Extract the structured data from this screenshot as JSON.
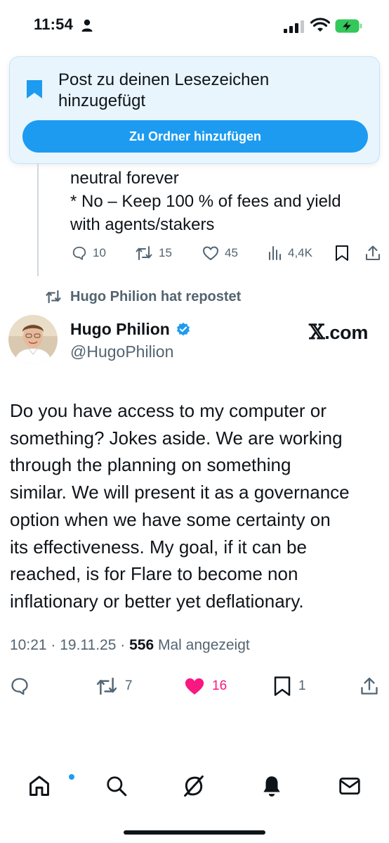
{
  "status_bar": {
    "time": "11:54"
  },
  "toast": {
    "message": "Post zu deinen Lesezeichen hinzugefügt",
    "button_label": "Zu Ordner hinzufügen"
  },
  "previous_post": {
    "text_lines": [
      "neutral forever",
      "* No – Keep 100 % of fees and yield",
      "with agents/stakers"
    ],
    "replies": "10",
    "reposts": "15",
    "likes": "45",
    "views": "4,4K"
  },
  "repost_header": {
    "label": "Hugo Philion hat repostet"
  },
  "post": {
    "author_name": "Hugo Philion",
    "author_handle": "@HugoPhilion",
    "source": ".com",
    "text_lines": [
      "Do you have access to my computer or",
      "something? Jokes aside. We are working",
      "through the planning on something",
      "similar. We will present it as a governance",
      "option when we have some certainty on",
      "its effectiveness. My goal, if it can be",
      "reached, is for Flare to become non",
      "inflationary or better yet deflationary."
    ],
    "time": "10:21",
    "date": "19.11.25",
    "views_count": "556",
    "views_label": "Mal angezeigt",
    "reposts": "7",
    "likes": "16",
    "bookmarks": "1"
  },
  "colors": {
    "accent": "#1d9bf0",
    "like": "#f91880",
    "muted": "#536471",
    "text": "#0f1419",
    "toast_bg": "#e8f5fd",
    "battery": "#34c759"
  },
  "icons": {
    "status_bar": [
      "person-icon",
      "signal-icon",
      "wifi-icon",
      "battery-charging-icon"
    ],
    "toast": [
      "bookmark-icon"
    ],
    "actions": [
      "reply-icon",
      "repost-icon",
      "like-icon",
      "views-icon",
      "bookmark-icon",
      "share-icon"
    ],
    "nav": [
      "home-icon",
      "search-icon",
      "grok-icon",
      "notifications-icon",
      "messages-icon"
    ]
  }
}
